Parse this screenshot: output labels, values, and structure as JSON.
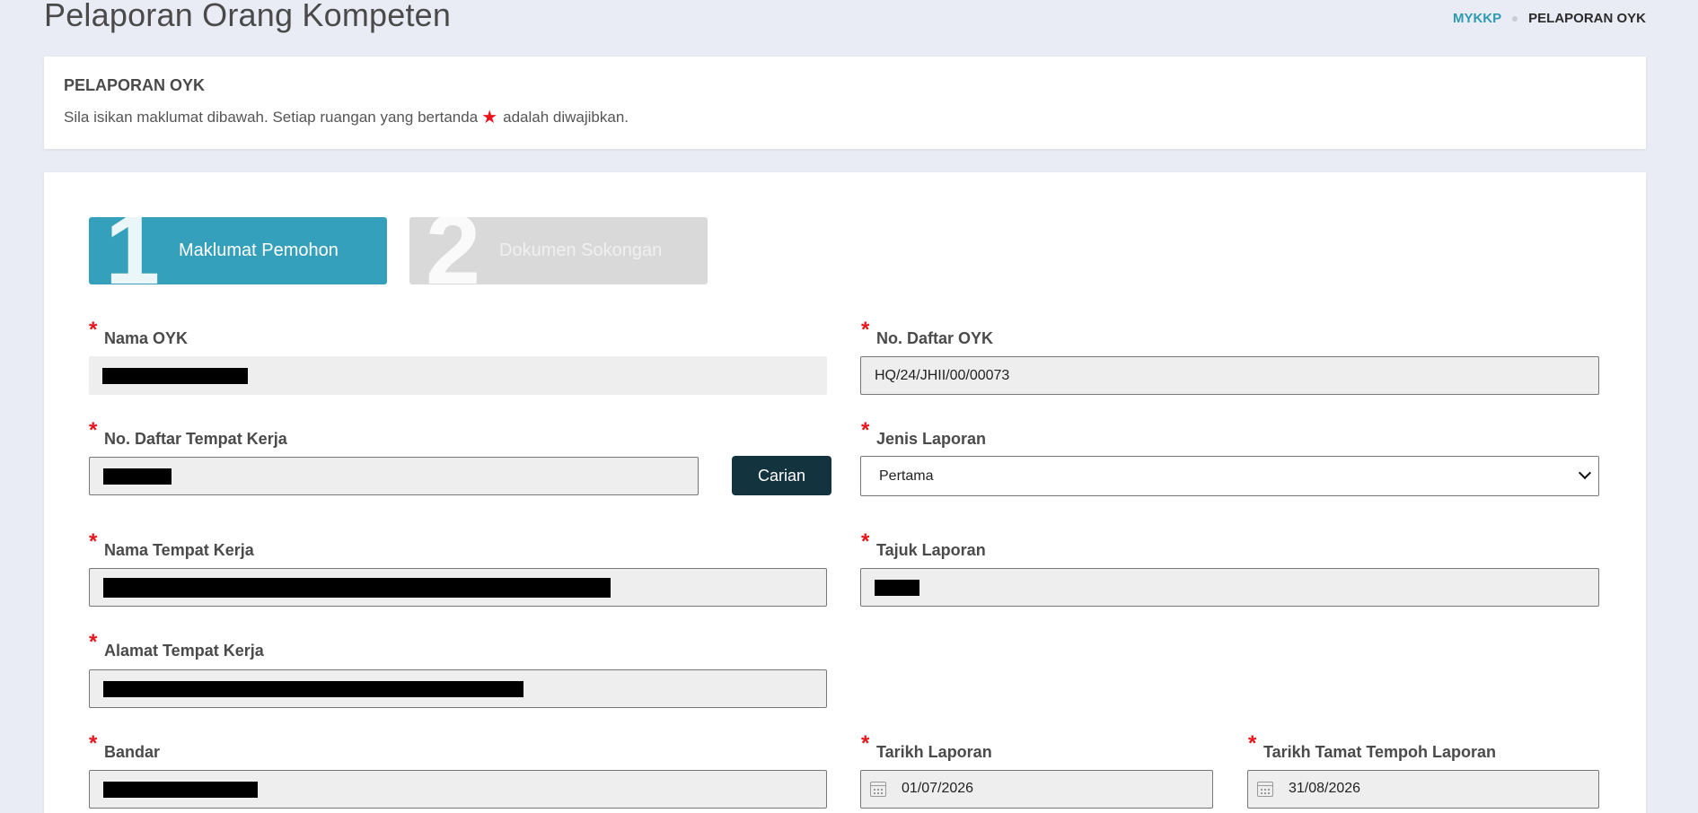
{
  "page": {
    "title": "Pelaporan Orang Kompeten",
    "breadcrumb": {
      "home": "MYKKP",
      "current": "PELAPORAN OYK"
    }
  },
  "info_card": {
    "title": "PELAPORAN OYK",
    "desc_before": "Sila isikan maklumat dibawah. Setiap ruangan yang bertanda",
    "desc_after": "adalah diwajibkan.",
    "required_symbol": "★"
  },
  "steps": [
    {
      "number": "1",
      "label": "Maklumat Pemohon",
      "active": true
    },
    {
      "number": "2",
      "label": "Dokumen Sokongan",
      "active": false
    }
  ],
  "form": {
    "required_mark": "*",
    "nama_oyk": {
      "label": "Nama OYK",
      "value_redacted": true
    },
    "no_daftar_oyk": {
      "label": "No. Daftar OYK",
      "value": "HQ/24/JHII/00/00073"
    },
    "no_daftar_tempat_kerja": {
      "label": "No. Daftar Tempat Kerja",
      "value_redacted": true
    },
    "carian_button": "Carian",
    "jenis_laporan": {
      "label": "Jenis Laporan",
      "selected": "Pertama"
    },
    "nama_tempat_kerja": {
      "label": "Nama Tempat Kerja",
      "value_redacted": true
    },
    "tajuk_laporan": {
      "label": "Tajuk Laporan",
      "value_redacted": true
    },
    "alamat_tempat_kerja": {
      "label": "Alamat Tempat Kerja",
      "value_redacted": true
    },
    "bandar": {
      "label": "Bandar",
      "value_redacted": true
    },
    "tarikh_laporan": {
      "label": "Tarikh Laporan",
      "value": "01/07/2026"
    },
    "tarikh_tamat": {
      "label": "Tarikh Tamat Tempoh Laporan",
      "value": "31/08/2026"
    }
  },
  "colors": {
    "accent": "#35a0bc",
    "button_dark": "#13343e",
    "required": "#e8141b",
    "background": "#e9ecf4"
  }
}
